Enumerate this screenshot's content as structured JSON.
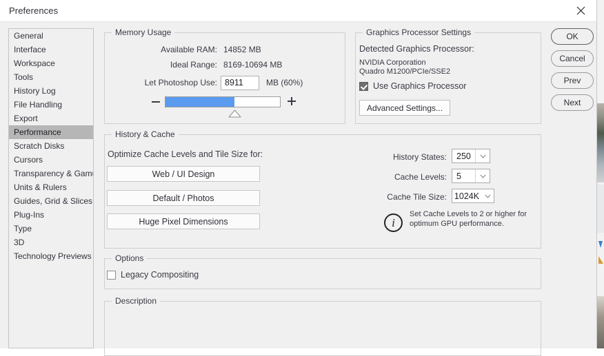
{
  "window": {
    "title": "Preferences",
    "close_icon": "close-icon"
  },
  "sidebar": {
    "items": [
      {
        "label": "General",
        "selected": false
      },
      {
        "label": "Interface",
        "selected": false
      },
      {
        "label": "Workspace",
        "selected": false
      },
      {
        "label": "Tools",
        "selected": false
      },
      {
        "label": "History Log",
        "selected": false
      },
      {
        "label": "File Handling",
        "selected": false
      },
      {
        "label": "Export",
        "selected": false
      },
      {
        "label": "Performance",
        "selected": true
      },
      {
        "label": "Scratch Disks",
        "selected": false
      },
      {
        "label": "Cursors",
        "selected": false
      },
      {
        "label": "Transparency & Gamut",
        "selected": false
      },
      {
        "label": "Units & Rulers",
        "selected": false
      },
      {
        "label": "Guides, Grid & Slices",
        "selected": false
      },
      {
        "label": "Plug-Ins",
        "selected": false
      },
      {
        "label": "Type",
        "selected": false
      },
      {
        "label": "3D",
        "selected": false
      },
      {
        "label": "Technology Previews",
        "selected": false
      }
    ]
  },
  "actions": {
    "ok": "OK",
    "cancel": "Cancel",
    "prev": "Prev",
    "next": "Next"
  },
  "memory_usage": {
    "legend": "Memory Usage",
    "available_ram_label": "Available RAM:",
    "available_ram_value": "14852 MB",
    "ideal_range_label": "Ideal Range:",
    "ideal_range_value": "8169-10694 MB",
    "let_use_label": "Let Photoshop Use:",
    "let_use_value": "8911",
    "let_use_suffix": "MB (60%)",
    "slider_percent": 60,
    "decrease_icon": "minus-icon",
    "increase_icon": "plus-icon",
    "fill_color": "#5b9bef"
  },
  "graphics": {
    "legend": "Graphics Processor Settings",
    "detected_label": "Detected Graphics Processor:",
    "vendor": "NVIDIA Corporation",
    "model": "Quadro M1200/PCIe/SSE2",
    "use_gpu_label": "Use Graphics Processor",
    "use_gpu_checked": true,
    "advanced_button": "Advanced Settings..."
  },
  "history_cache": {
    "legend": "History & Cache",
    "optimize_label": "Optimize Cache Levels and Tile Size for:",
    "preset_buttons": [
      "Web / UI Design",
      "Default / Photos",
      "Huge Pixel Dimensions"
    ],
    "history_states_label": "History States:",
    "history_states_value": "250",
    "cache_levels_label": "Cache Levels:",
    "cache_levels_value": "5",
    "cache_tile_label": "Cache Tile Size:",
    "cache_tile_value": "1024K",
    "info_icon": "info-icon",
    "info_line1": "Set Cache Levels to 2 or higher for",
    "info_line2": "optimum GPU performance."
  },
  "options": {
    "legend": "Options",
    "legacy_compositing_label": "Legacy Compositing",
    "legacy_compositing_checked": false
  },
  "description": {
    "legend": "Description",
    "text": ""
  }
}
